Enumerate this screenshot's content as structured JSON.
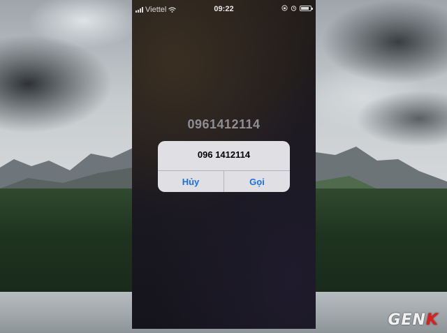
{
  "status_bar": {
    "carrier": "Viettel",
    "time": "09:22",
    "signal_icon": "signal-bars-icon",
    "wifi_icon": "wifi-icon",
    "orientation_lock_icon": "orientation-lock-icon",
    "alarm_icon": "alarm-icon",
    "battery_icon": "battery-icon",
    "battery_level": 0.85
  },
  "dialed_number": "0961412114",
  "alert": {
    "message": "096 1412114",
    "cancel_label": "Hủy",
    "call_label": "Gọi",
    "accent_color": "#1a6fe0"
  },
  "watermark": {
    "prefix": "GEN",
    "suffix": "K"
  }
}
